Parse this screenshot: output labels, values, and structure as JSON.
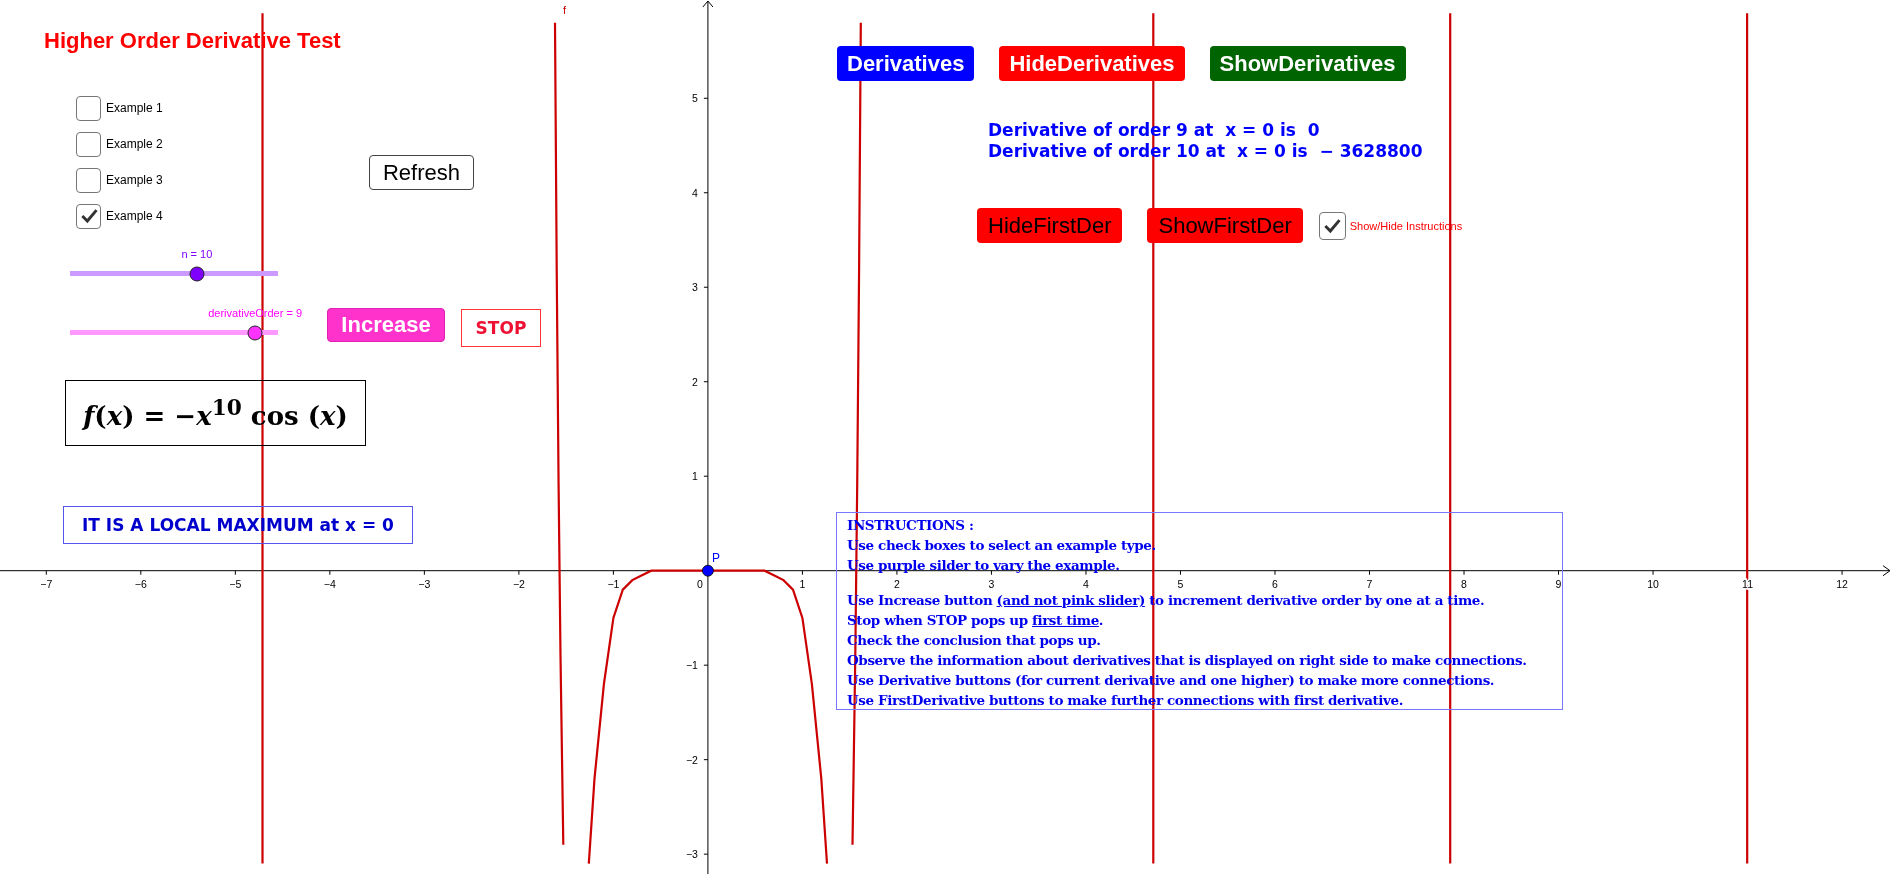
{
  "title": "Higher Order Derivative Test",
  "examples": [
    {
      "label": "Example 1",
      "checked": false
    },
    {
      "label": "Example 2",
      "checked": false
    },
    {
      "label": "Example 3",
      "checked": false
    },
    {
      "label": "Example 4",
      "checked": true
    }
  ],
  "refresh_button": "Refresh",
  "sliders": [
    {
      "kind": "purple",
      "label": "n = 10",
      "level": 0.61
    },
    {
      "kind": "pink",
      "label": "derivativeOrder = 9",
      "level": 0.89
    }
  ],
  "increase_button": "Increase",
  "stop_label": "STOP",
  "formula": "*f*(*x*) = −*x*$^{10}$ cos (*x*)",
  "conclusion": "IT IS A LOCAL MAXIMUM at x = 0",
  "derivative_buttons": [
    {
      "label": "Derivatives",
      "color": "#0000ff"
    },
    {
      "label": "HideDerivatives",
      "color": "#ff0000"
    },
    {
      "label": "ShowDerivatives",
      "color": "#006400"
    }
  ],
  "derivative_info": [
    "Derivative of order 9 at  x = 0 is  0",
    "Derivative of order 10 at  x = 0 is  − 3628800"
  ],
  "first_der_buttons": [
    "HideFirstDer",
    "ShowFirstDer"
  ],
  "instructions_toggle": {
    "label": "Show/Hide Instructions",
    "checked": true
  },
  "instructions": [
    [
      {
        "text": "INSTRUCTIONS :"
      }
    ],
    [
      {
        "text": "Use check boxes to select an example type."
      }
    ],
    [
      {
        "text": "Use purple silder to vary the example."
      }
    ],
    [
      {
        "text": "Use Increase button "
      },
      {
        "text": "(and not pink slider)",
        "underlined": true
      },
      {
        "text": " to increment derivative order by one at a time."
      }
    ],
    [
      {
        "text": "Stop when STOP pops up "
      },
      {
        "text": "first time",
        "underlined": true
      },
      {
        "text": "."
      }
    ],
    [
      {
        "text": "Check the conclusion that pops up."
      }
    ],
    [
      {
        "text": "Observe the information about derivatives that is displayed on right side to make connections."
      }
    ],
    [
      {
        "text": "Use Derivative buttons (for current derivative and one higher) to make more connections."
      }
    ],
    [
      {
        "text": "Use FirstDerivative buttons to make further connections with first derivative."
      }
    ]
  ],
  "graph": {
    "point_label": "P",
    "chart_data": {
      "type": "line",
      "x": [
        -4.7125,
        -4.7123,
        -3,
        -1.618,
        -1.6,
        -1.58,
        -1.56,
        -1.53,
        -1.4,
        -1.26,
        -1.2,
        -1.1,
        -1.0,
        -0.9,
        -0.8,
        -0.6,
        0,
        0.6,
        0.8,
        0.9,
        1.0,
        1.1,
        1.2,
        1.26,
        1.4,
        1.53,
        1.56,
        1.58,
        1.6,
        1.618,
        3,
        4.7123,
        4.7125,
        6,
        7.8539,
        7.8541,
        9,
        10.9955,
        10.9957
      ],
      "series": [
        {
          "name": "f",
          "color": "#cc0000",
          "values": [
            -3.1,
            5.9,
            null,
            5.8,
            3.2,
            0.9,
            -0.9,
            -2.9,
            null,
            -3.1,
            -2.2,
            -1.2,
            -0.5,
            -0.2,
            -0.1,
            0,
            0,
            0,
            -0.1,
            -0.2,
            -0.5,
            -1.2,
            -2.2,
            -3.1,
            null,
            -2.9,
            -0.9,
            0.9,
            3.2,
            5.8,
            null,
            5.9,
            -3.1,
            null,
            -3.1,
            5.9,
            null,
            5.9,
            -3.1
          ]
        }
      ],
      "xlim": [
        -7.49,
        12.56
      ],
      "ylim": [
        -3.21,
        6.04
      ],
      "xticks": [
        {
          "value": -7,
          "label": "−7"
        },
        {
          "value": -6,
          "label": "−6"
        },
        {
          "value": -5,
          "label": "−5"
        },
        {
          "value": -4,
          "label": "−4"
        },
        {
          "value": -3,
          "label": "−3"
        },
        {
          "value": -2,
          "label": "−2"
        },
        {
          "value": -1,
          "label": "−1"
        },
        0,
        1,
        2,
        3,
        4,
        5,
        6,
        7,
        8,
        9,
        10,
        11,
        12
      ],
      "yticks": [
        {
          "value": -3,
          "label": "−3"
        },
        {
          "value": -2,
          "label": "−2"
        },
        {
          "value": -1,
          "label": "−1"
        },
        1,
        2,
        3,
        4,
        5
      ]
    }
  }
}
